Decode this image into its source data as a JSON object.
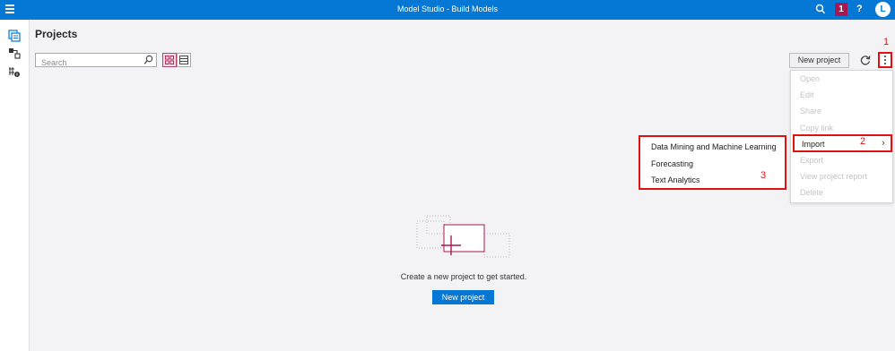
{
  "app": {
    "title": "Model Studio - Build Models",
    "notification_count": "1",
    "help_label": "?",
    "user_initial": "L"
  },
  "page": {
    "title": "Projects"
  },
  "search": {
    "placeholder": "Search"
  },
  "toolbar": {
    "new_project_label": "New project"
  },
  "annotations": {
    "a1": "1",
    "a2": "2",
    "a3": "3"
  },
  "menu": {
    "items": [
      {
        "label": "Open",
        "enabled": false
      },
      {
        "label": "Edit",
        "enabled": false
      },
      {
        "label": "Share",
        "enabled": false
      },
      {
        "label": "Copy link",
        "enabled": false
      },
      {
        "label": "Import",
        "enabled": true
      },
      {
        "label": "Export",
        "enabled": false
      },
      {
        "label": "View project report",
        "enabled": false
      },
      {
        "label": "Delete",
        "enabled": false
      }
    ]
  },
  "submenu": {
    "items": [
      {
        "label": "Data Mining and Machine Learning"
      },
      {
        "label": "Forecasting"
      },
      {
        "label": "Text Analytics"
      }
    ]
  },
  "empty_state": {
    "message": "Create a new project to get started.",
    "button_label": "New project"
  },
  "colors": {
    "brand": "#0478d4",
    "accent": "#a8174f",
    "annotation": "#e01111"
  },
  "icons": [
    "menu-icon",
    "search-icon",
    "help-icon",
    "projects-icon",
    "pipelines-icon",
    "exchange-icon",
    "grid-view-icon",
    "list-view-icon",
    "refresh-icon",
    "more-options-icon",
    "chevron-right-icon"
  ]
}
